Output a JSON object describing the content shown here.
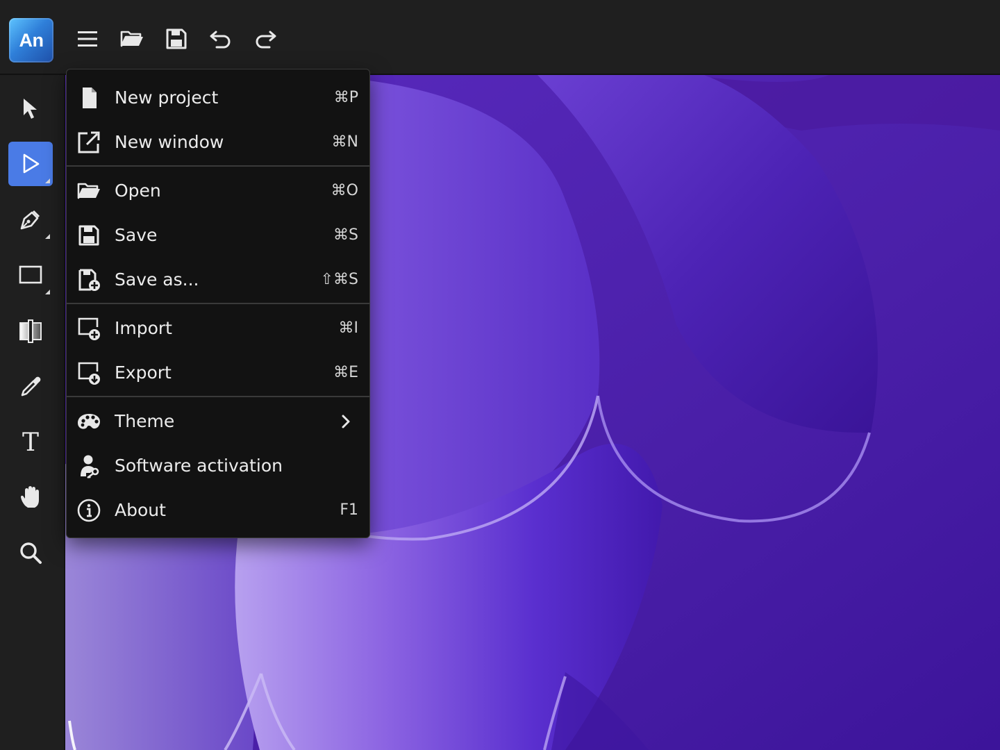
{
  "app": {
    "logo_text": "An",
    "brand_color": "#2f7fd9"
  },
  "toolbar": {
    "buttons": [
      {
        "icon": "hamburger-menu-icon",
        "label": "Menu"
      },
      {
        "icon": "folder-open-icon",
        "label": "Open"
      },
      {
        "icon": "save-icon",
        "label": "Save"
      },
      {
        "icon": "undo-icon",
        "label": "Undo"
      },
      {
        "icon": "redo-icon",
        "label": "Redo"
      }
    ]
  },
  "tools": [
    {
      "icon": "select-arrow-icon",
      "active": false
    },
    {
      "icon": "direct-select-arrow-icon",
      "active": true
    },
    {
      "icon": "pen-tool-icon",
      "active": false
    },
    {
      "icon": "rectangle-tool-icon",
      "active": false
    },
    {
      "icon": "gradient-tool-icon",
      "active": false
    },
    {
      "icon": "eyedropper-icon",
      "active": false
    },
    {
      "icon": "text-tool-icon",
      "active": false
    },
    {
      "icon": "hand-tool-icon",
      "active": false
    },
    {
      "icon": "zoom-tool-icon",
      "active": false
    }
  ],
  "menu": {
    "items": [
      {
        "label": "New project",
        "shortcut": "⌘P",
        "icon": "new-file-icon"
      },
      {
        "label": "New window",
        "shortcut": "⌘N",
        "icon": "new-window-icon"
      },
      {
        "label": "Open",
        "shortcut": "⌘O",
        "icon": "folder-open-icon"
      },
      {
        "label": "Save",
        "shortcut": "⌘S",
        "icon": "save-icon"
      },
      {
        "label": "Save as...",
        "shortcut": "⇧⌘S",
        "icon": "save-as-icon"
      },
      {
        "label": "Import",
        "shortcut": "⌘I",
        "icon": "import-icon"
      },
      {
        "label": "Export",
        "shortcut": "⌘E",
        "icon": "export-icon"
      },
      {
        "label": "Theme",
        "shortcut": "",
        "icon": "palette-icon",
        "submenu": true
      },
      {
        "label": "Software activation",
        "shortcut": "",
        "icon": "activation-key-icon"
      },
      {
        "label": "About",
        "shortcut": "F1",
        "icon": "info-icon"
      }
    ]
  },
  "colors": {
    "active_tool": "#4a7be6",
    "canvas_dark": "#3d17a0",
    "canvas_light": "#a58be8"
  }
}
